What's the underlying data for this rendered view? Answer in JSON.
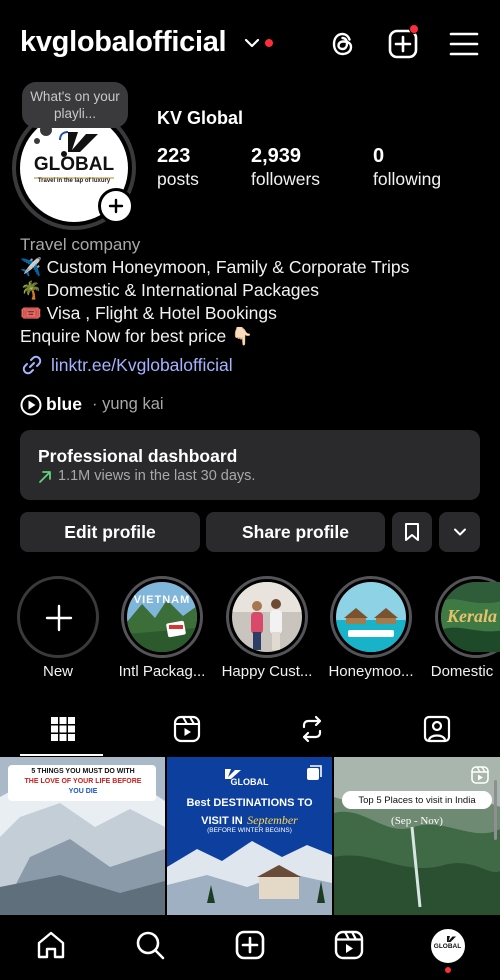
{
  "header": {
    "username": "kvglobalofficial"
  },
  "profile": {
    "note": "What's on your playli...",
    "display_name": "KV Global",
    "logo_text": "GLOBAL",
    "logo_tagline": "Travel in the lap of luxury",
    "stats": [
      {
        "value": "223",
        "label": "posts"
      },
      {
        "value": "2,939",
        "label": "followers"
      },
      {
        "value": "0",
        "label": "following"
      }
    ],
    "category": "Travel company",
    "bio_lines": [
      "✈️ Custom Honeymoon, Family & Corporate Trips",
      "🌴 Domestic & International Packages",
      "🎟️ Visa , Flight & Hotel Bookings",
      "Enquire Now for best price 👇🏻"
    ],
    "link": "linktr.ee/Kvglobalofficial",
    "music": {
      "title": "blue",
      "artist": "· yung kai"
    }
  },
  "dashboard": {
    "title": "Professional dashboard",
    "subtitle": "1.1M views in the last 30 days."
  },
  "actions": {
    "edit": "Edit profile",
    "share": "Share profile"
  },
  "highlights": [
    {
      "label": "New"
    },
    {
      "label": "Intl Packag...",
      "image_text": "VIETNAM"
    },
    {
      "label": "Happy Cust..."
    },
    {
      "label": "Honeymoo..."
    },
    {
      "label": "Domestic",
      "image_text": "Kerala"
    }
  ],
  "posts": [
    {
      "lines": [
        "5 THINGS YOU MUST DO WITH",
        "THE LOVE OF YOUR LIFE BEFORE",
        "YOU DIE"
      ]
    },
    {
      "brand": "GLOBAL",
      "headline1": "Best DESTINATIONS TO",
      "headline2": "VISIT IN",
      "headline_script": "September",
      "sub": "(BEFORE WINTER BEGINS)"
    },
    {
      "pill": "Top 5 Places to visit in India",
      "sub": "(Sep - Nov)"
    }
  ],
  "nav": {
    "avatar_text": "GLOBAL"
  },
  "colors": {
    "background": "#000000",
    "surface": "#2a2a2d",
    "link": "#a5b3ff",
    "notification": "#ff2d3a",
    "secondary_text": "#a8a8a8"
  },
  "icons": [
    "chevron-down-icon",
    "threads-icon",
    "add-post-icon",
    "menu-icon",
    "plus-icon",
    "link-icon",
    "play-icon",
    "trend-arrow-icon",
    "bookmark-icon",
    "chevron-down-icon",
    "grid-icon",
    "reels-icon",
    "repost-icon",
    "tagged-icon",
    "home-icon",
    "search-icon",
    "create-icon",
    "reels-nav-icon",
    "profile-avatar"
  ]
}
